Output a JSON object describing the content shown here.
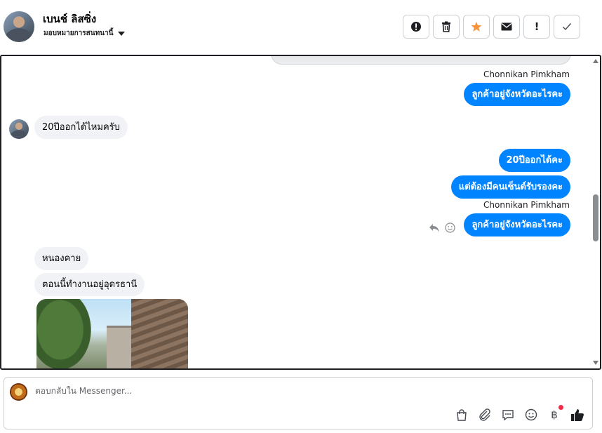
{
  "header": {
    "contact_name": "เบนช์ ลิสซิ่ง",
    "assign_label": "มอบหมายการสนทนานี้",
    "actions": [
      {
        "icon": "alert-circle-icon",
        "glyph": "!"
      },
      {
        "icon": "trash-icon",
        "glyph": "🗑"
      },
      {
        "icon": "star-icon",
        "glyph": "★"
      },
      {
        "icon": "envelope-icon",
        "glyph": "✉"
      },
      {
        "icon": "exclamation-icon",
        "glyph": "!"
      },
      {
        "icon": "check-icon",
        "glyph": "✓"
      }
    ]
  },
  "messages": {
    "sender_1": "Chonnikan Pimkham",
    "out_1": "ลูกค้าอยู่จังหวัดอะไรคะ",
    "in_1": "20ปีออกได้ไหมครับ",
    "out_2": "20ปีออกได้คะ",
    "out_3": "แต่ต้องมีคนเซ็นต์รับรองคะ",
    "sender_2": "Chonnikan Pimkham",
    "out_4": "ลูกค้าอยู่จังหวัดอะไรคะ",
    "in_2": "หนองคาย",
    "in_3": "ตอนนี้ทำงานอยู่อุดรธานี"
  },
  "composer": {
    "placeholder": "ตอบกลับใน Messenger...",
    "currency_glyph": "฿"
  },
  "colors": {
    "outgoing_bubble": "#0084ff",
    "incoming_bubble": "#f0f2f5",
    "star": "#f7923b",
    "notification_dot": "#f02849"
  }
}
